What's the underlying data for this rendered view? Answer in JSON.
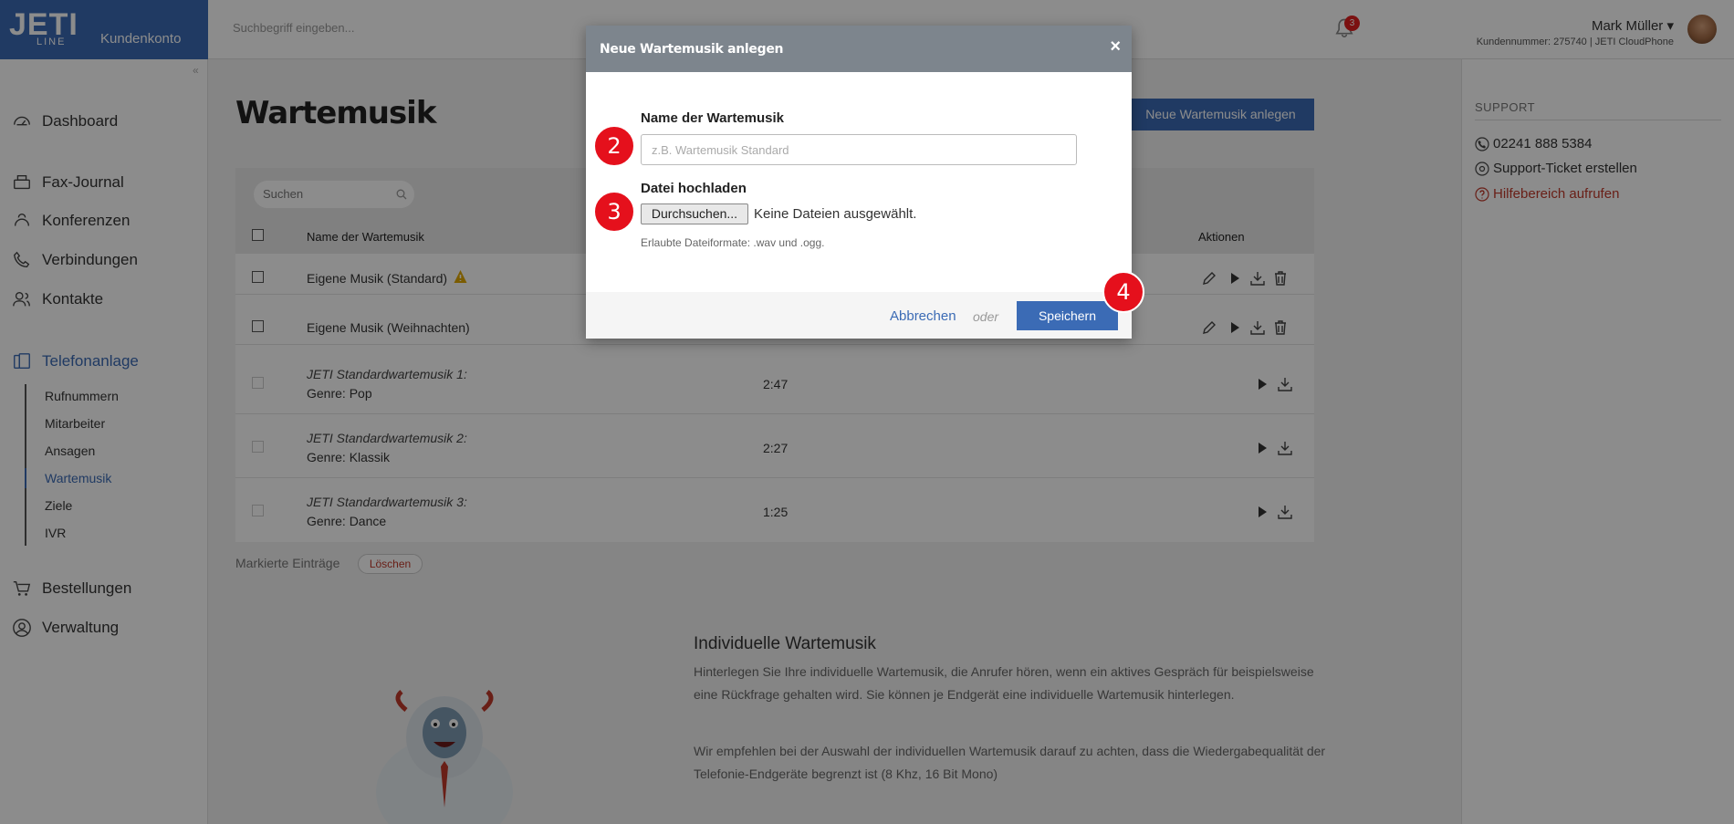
{
  "topbar": {
    "logo_main": "JETI",
    "logo_line": "LINE",
    "logo_sub": "Kundenkonto",
    "search_placeholder": "Suchbegriff eingeben...",
    "notification_count": "3",
    "user_name": "Mark Müller ▾",
    "user_sub": "Kundennummer: 275740 | JETI CloudPhone"
  },
  "sidebar": {
    "collapse": "«",
    "items": [
      {
        "label": "Dashboard",
        "icon": "dashboard-icon"
      },
      {
        "label": "Fax-Journal",
        "icon": "fax-icon"
      },
      {
        "label": "Konferenzen",
        "icon": "conference-icon"
      },
      {
        "label": "Verbindungen",
        "icon": "phone-icon"
      },
      {
        "label": "Kontakte",
        "icon": "contacts-icon"
      },
      {
        "label": "Telefonanlage",
        "icon": "phone-system-icon",
        "active": true
      },
      {
        "label": "Bestellungen",
        "icon": "cart-icon"
      },
      {
        "label": "Verwaltung",
        "icon": "user-icon"
      }
    ],
    "subitems": [
      "Rufnummern",
      "Mitarbeiter",
      "Ansagen",
      "Wartemusik",
      "Ziele",
      "IVR"
    ],
    "active_sub": "Wartemusik"
  },
  "main": {
    "title": "Wartemusik",
    "new_button": "Neue Wartemusik anlegen",
    "search_placeholder": "Suchen",
    "columns": {
      "name": "Name der Wartemusik",
      "actions": "Aktionen"
    },
    "rows": [
      {
        "name": "Eigene Musik (Standard)",
        "duration": "",
        "warning": true
      },
      {
        "name": "Eigene Musik (Weihnachten)",
        "duration": ""
      },
      {
        "name_italic": "JETI Standardwartemusik 1:",
        "genre": "Genre: Pop",
        "duration": "2:47"
      },
      {
        "name_italic": "JETI Standardwartemusik 2:",
        "genre": "Genre: Klassik",
        "duration": "2:27"
      },
      {
        "name_italic": "JETI Standardwartemusik 3:",
        "genre": "Genre: Dance",
        "duration": "1:25"
      }
    ],
    "marked_label": "Markierte Einträge",
    "delete_button": "Löschen",
    "info_title": "Individuelle Wartemusik",
    "info_p1": "Hinterlegen Sie Ihre individuelle Wartemusik, die Anrufer hören, wenn ein aktives Gespräch für beispielsweise eine Rückfrage gehalten wird. Sie können je Endgerät eine individuelle Wartemusik hinterlegen.",
    "info_p2": "Wir empfehlen bei der Auswahl der individuellen Wartemusik darauf zu achten, dass die Wiedergabequalität der Telefonie-Endgeräte begrenzt ist (8 Khz, 16 Bit Mono)"
  },
  "support": {
    "heading": "SUPPORT",
    "phone": "02241 888 5384",
    "ticket": "Support-Ticket erstellen",
    "help": "Hilfebereich aufrufen"
  },
  "modal": {
    "title": "Neue Wartemusik anlegen",
    "close": "×",
    "name_label": "Name der Wartemusik",
    "name_placeholder": "z.B. Wartemusik Standard",
    "file_label": "Datei hochladen",
    "browse_button": "Durchsuchen...",
    "no_file": "Keine Dateien ausgewählt.",
    "hint": "Erlaubte Dateiformate: .wav und .ogg.",
    "cancel": "Abbrechen",
    "or": "oder",
    "save": "Speichern"
  },
  "steps": [
    "2",
    "3",
    "4"
  ],
  "colors": {
    "brand": "#3b6bb5",
    "step": "#e5101c",
    "danger": "#c0392b"
  }
}
